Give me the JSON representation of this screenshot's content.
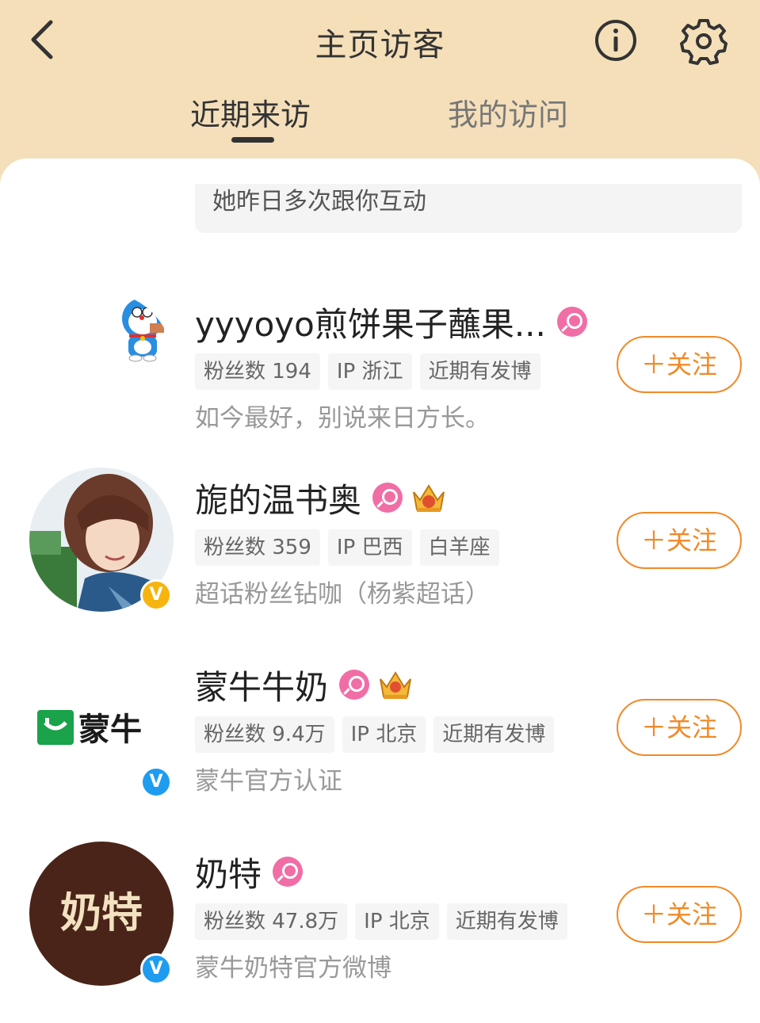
{
  "header": {
    "title": "主页访客",
    "tabs": [
      {
        "label": "近期来访",
        "active": true
      },
      {
        "label": "我的访问",
        "active": false
      }
    ]
  },
  "note": "她昨日多次跟你互动",
  "follow_label": "＋关注",
  "colors": {
    "accent": "#f08a28",
    "female": "#f06ea5",
    "verify_gold": "#f6b40e",
    "verify_blue": "#1e9cf0"
  },
  "visitors": [
    {
      "name": "yyyoyo煎饼果子蘸果...",
      "avatar_icon": "doraemon-avatar",
      "gender": "female",
      "tags": [
        "粉丝数 194",
        "IP 浙江",
        "近期有发博"
      ],
      "desc": "如今最好，别说来日方长。"
    },
    {
      "name": "旎的温书奥",
      "avatar_icon": "portrait-avatar",
      "gender": "female",
      "badge": "crown",
      "verify": "gold",
      "tags": [
        "粉丝数 359",
        "IP 巴西",
        "白羊座"
      ],
      "desc": "超话粉丝钻咖（杨紫超话）"
    },
    {
      "name": "蒙牛牛奶",
      "avatar_icon": "mengniu-logo",
      "logo_text": "蒙牛",
      "gender": "female",
      "badge": "crown",
      "verify": "blue",
      "tags": [
        "粉丝数 9.4万",
        "IP 北京",
        "近期有发博"
      ],
      "desc": "蒙牛官方认证"
    },
    {
      "name": "奶特",
      "avatar_icon": "naite-logo",
      "logo_text": "奶特",
      "gender": "female",
      "verify": "blue",
      "tags": [
        "粉丝数 47.8万",
        "IP 北京",
        "近期有发博"
      ],
      "desc": "蒙牛奶特官方微博"
    }
  ]
}
